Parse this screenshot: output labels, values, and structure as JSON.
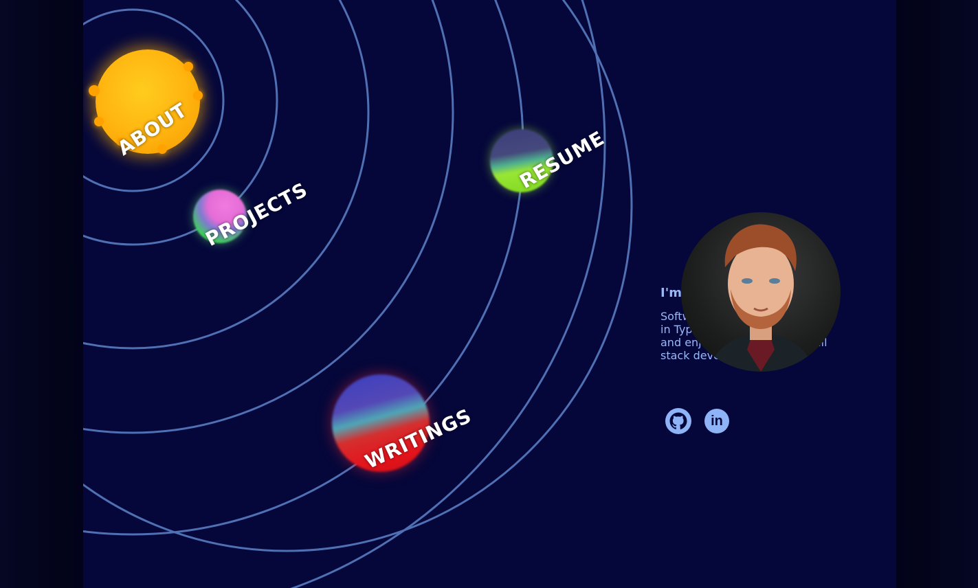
{
  "nav": {
    "about": "About",
    "projects": "Projects",
    "resume": "Resume",
    "writings": "Writings"
  },
  "intro": {
    "title": "I'm",
    "bio": "Software engineer experienced in Typescript, React, Next.js, and enjoying a career as a full stack developer."
  },
  "social": {
    "github_icon": "github-icon",
    "linkedin_icon": "linkedin-icon",
    "linkedin_text": "in"
  },
  "colors": {
    "background": "#05073a",
    "orbit": "#5070b4",
    "text_accent": "#9ab8f8",
    "sun": "#ffb30f"
  }
}
